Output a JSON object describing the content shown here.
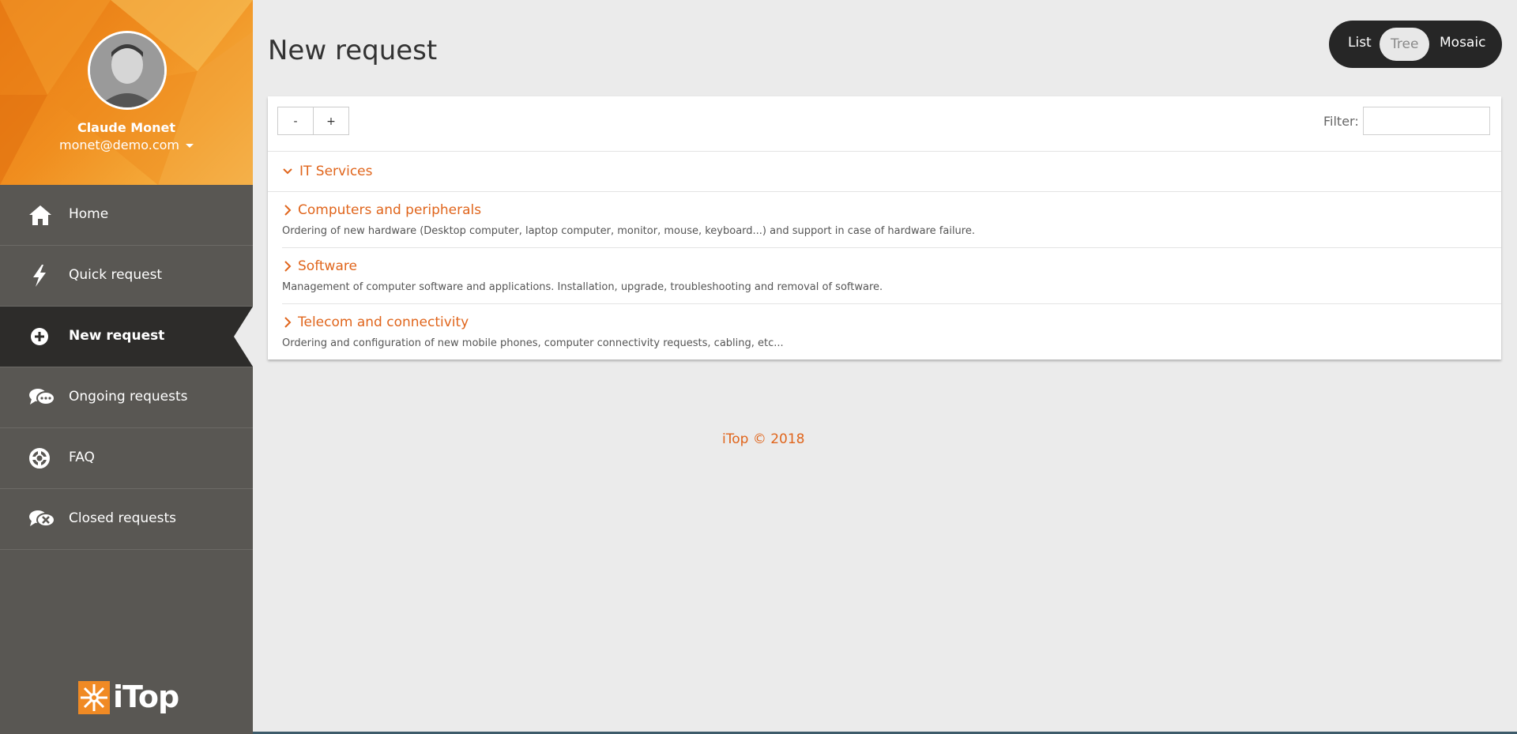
{
  "user": {
    "name": "Claude Monet",
    "email": "monet@demo.com"
  },
  "nav": {
    "items": [
      {
        "label": "Home",
        "icon": "home-icon"
      },
      {
        "label": "Quick request",
        "icon": "lightning-icon"
      },
      {
        "label": "New request",
        "icon": "plus-circle-icon",
        "active": true
      },
      {
        "label": "Ongoing requests",
        "icon": "chat-bubbles-icon"
      },
      {
        "label": "FAQ",
        "icon": "lifebuoy-icon"
      },
      {
        "label": "Closed requests",
        "icon": "chat-closed-icon"
      }
    ]
  },
  "brand": {
    "name": "iTop"
  },
  "page": {
    "title": "New request"
  },
  "view_switch": {
    "options": [
      "List",
      "Tree",
      "Mosaic"
    ],
    "selected": "Tree"
  },
  "toolbar": {
    "collapse_label": "-",
    "expand_label": "+",
    "filter_label": "Filter:",
    "filter_value": ""
  },
  "tree": {
    "root": {
      "label": "IT Services",
      "expanded": true
    },
    "children": [
      {
        "title": "Computers and peripherals",
        "description": "Ordering of new hardware (Desktop computer, laptop computer, monitor, mouse, keyboard...) and support in case of hardware failure."
      },
      {
        "title": "Software",
        "description": "Management of computer software and applications. Installation, upgrade, troubleshooting and removal of software."
      },
      {
        "title": "Telecom and connectivity",
        "description": "Ordering and configuration of new mobile phones, computer connectivity requests, cabling, etc..."
      }
    ]
  },
  "footer": {
    "text": "iTop © 2018"
  },
  "colors": {
    "accent": "#e0651c",
    "sidebar": "#595753",
    "sidebar_active": "#2d2c2a"
  }
}
